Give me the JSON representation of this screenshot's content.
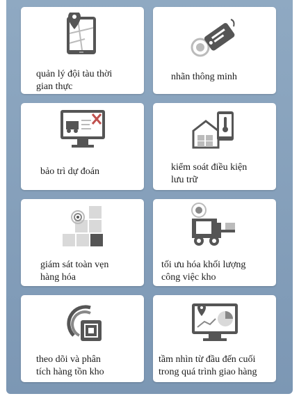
{
  "cards": [
    {
      "icon": "tablet-map-icon",
      "line1": "quản lý đội tàu thời",
      "line2": "gian thực"
    },
    {
      "icon": "smart-tag-icon",
      "line1": "nhãn thông minh",
      "line2": ""
    },
    {
      "icon": "monitor-tools-icon",
      "line1": "bảo trì dự đoán",
      "line2": ""
    },
    {
      "icon": "warehouse-thermometer-icon",
      "line1": "kiểm soát điều kiện",
      "line2": "lưu trữ"
    },
    {
      "icon": "inventory-blocks-icon",
      "line1": "giám sát toàn vẹn",
      "line2": "hàng hóa"
    },
    {
      "icon": "forklift-icon",
      "line1": "tối ưu hóa khối lượng",
      "line2": "công việc kho"
    },
    {
      "icon": "rfid-signal-icon",
      "line1": "theo dõi và phân",
      "line2": "tích hàng tồn kho"
    },
    {
      "icon": "monitor-chart-icon",
      "line1": "tầm nhìn từ đầu đến cuối",
      "line2": "trong quá trình giao hàng"
    }
  ]
}
